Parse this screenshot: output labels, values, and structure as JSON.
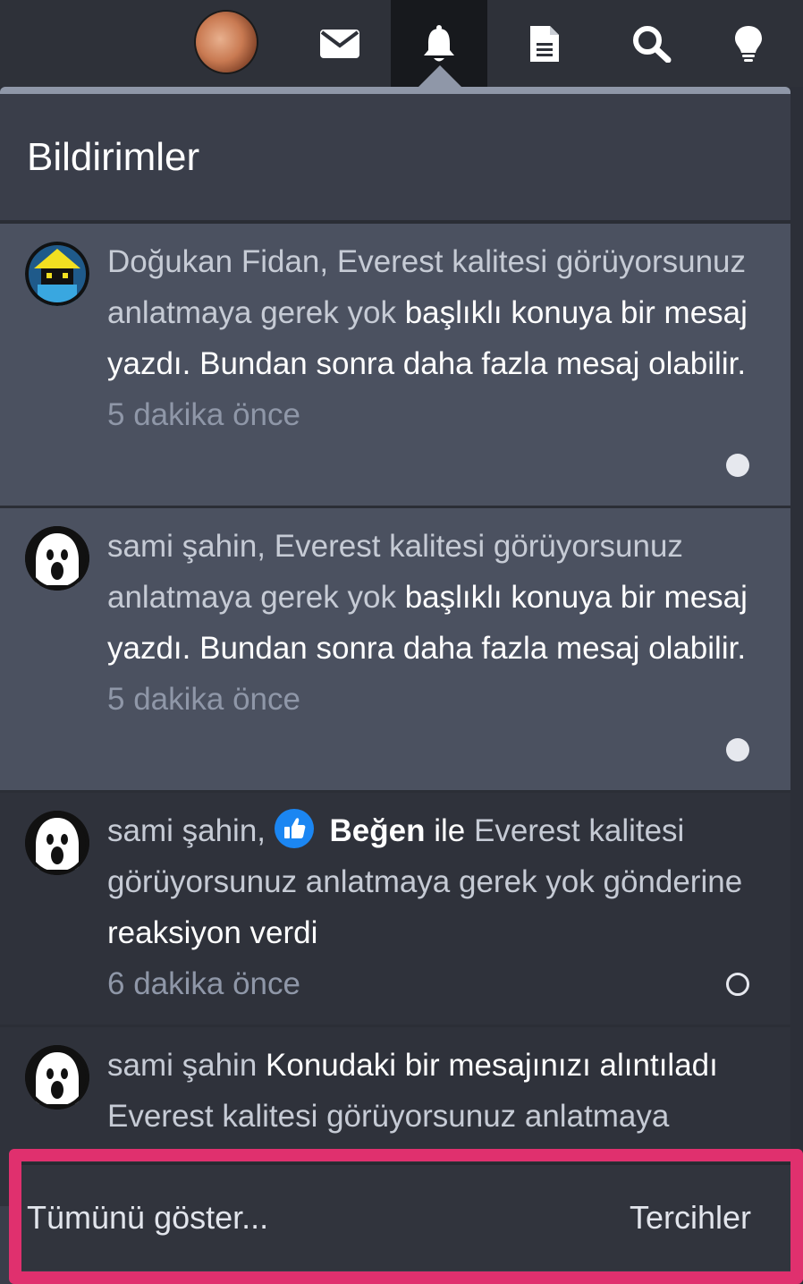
{
  "navbar": {
    "icons": [
      "user-avatar",
      "envelope-icon",
      "bell-icon",
      "document-icon",
      "search-icon",
      "lightbulb-icon"
    ],
    "active": "bell-icon"
  },
  "panel": {
    "title": "Bildirimler"
  },
  "notifications": [
    {
      "user": "Doğukan Fidan,",
      "thread": "Everest kalitesi görüyorsunuz anlatmaya gerek yok",
      "text": "başlıklı konuya bir mesaj yazdı. Bundan sonra daha fazla mesaj olabilir.",
      "time": "5 dakika önce",
      "state": "unread"
    },
    {
      "user": "sami şahin,",
      "thread": "Everest kalitesi görüyorsunuz anlatmaya gerek yok",
      "text": "başlıklı konuya bir mesaj yazdı. Bundan sonra daha fazla mesaj olabilir.",
      "time": "5 dakika önce",
      "state": "unread"
    },
    {
      "user": "sami şahin,",
      "reaction": "Beğen",
      "reaction_prefix": "ile",
      "thread": "Everest kalitesi görüyorsunuz anlatmaya gerek yok",
      "post_word": "gönderine",
      "text": "reaksiyon verdi",
      "time": "6 dakika önce",
      "state": "read"
    },
    {
      "user": "sami şahin",
      "text": "Konudaki bir mesajınızı alıntıladı",
      "thread": "Everest kalitesi görüyorsunuz anlatmaya",
      "state": "read"
    }
  ],
  "footer": {
    "show_all": "Tümünü göster...",
    "preferences": "Tercihler"
  },
  "colors": {
    "highlight": "#e0306e",
    "unread_bg": "#4b5160",
    "read_bg": "#2f323b",
    "like_badge": "#1b86f2"
  }
}
